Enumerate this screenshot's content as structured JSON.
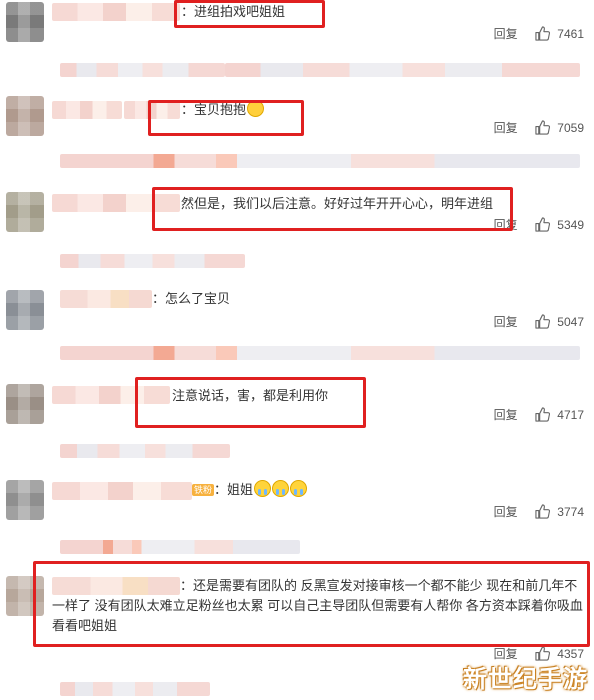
{
  "reply_label": "回复",
  "comments": [
    {
      "text": "：进组拍戏吧姐姐",
      "likes": "7461",
      "avatar_colors": [
        "#7a7a7a",
        "#4d4d4d"
      ]
    },
    {
      "text": "：宝贝抱抱",
      "emoji": "heart-face-icon",
      "likes": "7059",
      "avatar_colors": [
        "#b09a8e",
        "#e7dad0"
      ]
    },
    {
      "text": "然但是，我们以后注意。好好过年开开心心，明年进组",
      "likes": "5349",
      "avatar_colors": [
        "#a29d8a",
        "#d9d2bc"
      ]
    },
    {
      "text": "：怎么了宝贝",
      "likes": "5047",
      "avatar_colors": [
        "#8a8f96",
        "#c2c6cc"
      ]
    },
    {
      "text": "注意说话，害，都是利用你",
      "likes": "4717",
      "avatar_colors": [
        "#9a8f86",
        "#6e6660"
      ]
    },
    {
      "text": "：姐姐",
      "badge": "铁粉",
      "emoji": "crying-face-icon",
      "likes": "3774",
      "avatar_colors": [
        "#8f8f8f",
        "#5a5a5a"
      ]
    },
    {
      "text": "：还是需要有团队的 反黑宣发对接审核一个都不能少 现在和前几年不一样了 没有团队太难立足粉丝也太累 可以自己主导团队但需要有人帮你 各方资本踩着你吸血 看看吧姐姐",
      "likes": "4357",
      "avatar_colors": [
        "#b7a79b",
        "#7e6f66"
      ]
    }
  ],
  "watermark": "新世纪手游"
}
